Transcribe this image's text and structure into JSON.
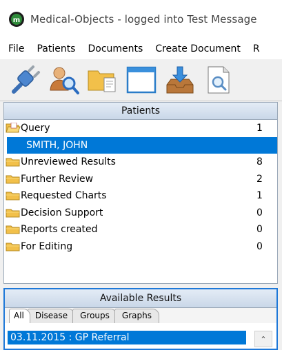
{
  "window": {
    "title": "Medical-Objects - logged into Test Message"
  },
  "menu": [
    "File",
    "Patients",
    "Documents",
    "Create Document",
    "R"
  ],
  "toolbar": {
    "buttons": [
      {
        "name": "plug-icon"
      },
      {
        "name": "find-patient-icon"
      },
      {
        "name": "folder-document-icon"
      },
      {
        "name": "window-icon"
      },
      {
        "name": "download-tray-icon"
      },
      {
        "name": "document-search-icon"
      }
    ]
  },
  "patients": {
    "header": "Patients",
    "rows": [
      {
        "label": "Query",
        "count": "1",
        "icon": "open-folder-icon",
        "selected": false
      },
      {
        "label": "SMITH, JOHN",
        "count": "",
        "icon": "",
        "selected": true
      },
      {
        "label": "Unreviewed Results",
        "count": "8",
        "icon": "folder-icon",
        "selected": false
      },
      {
        "label": "Further Review",
        "count": "2",
        "icon": "folder-icon",
        "selected": false
      },
      {
        "label": "Requested Charts",
        "count": "1",
        "icon": "folder-icon",
        "selected": false
      },
      {
        "label": "Decision Support",
        "count": "0",
        "icon": "folder-icon",
        "selected": false
      },
      {
        "label": "Reports created",
        "count": "0",
        "icon": "folder-icon",
        "selected": false
      },
      {
        "label": "For Editing",
        "count": "0",
        "icon": "folder-icon",
        "selected": false
      }
    ]
  },
  "results": {
    "header": "Available Results",
    "tabs": [
      "All",
      "Disease",
      "Groups",
      "Graphs"
    ],
    "active_tab": "All",
    "items": [
      "03.11.2015 : GP Referral"
    ]
  },
  "colors": {
    "selection": "#0078d7",
    "accent_border": "#1e78d8"
  }
}
